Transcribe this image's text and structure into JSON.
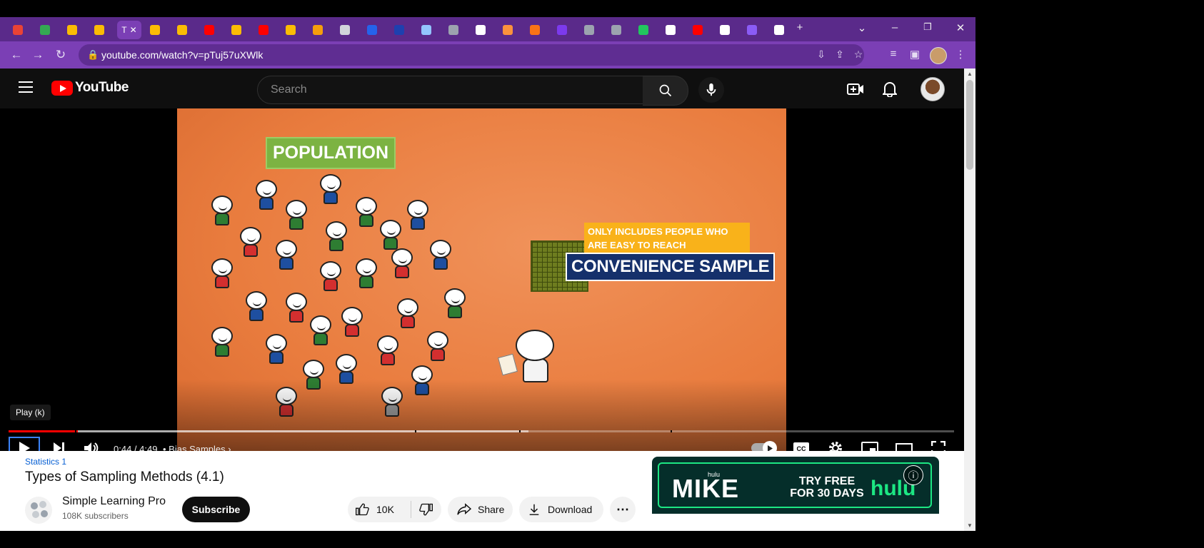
{
  "browser": {
    "url": "youtube.com/watch?v=pTuj57uXWlk",
    "active_tab_letter": "T",
    "tabs": [
      {
        "color": "#ea4335"
      },
      {
        "color": "#34a853"
      },
      {
        "color": "#fbbc04"
      },
      {
        "color": "#fbbc04"
      },
      {
        "color": "active"
      },
      {
        "color": "#fbbc04"
      },
      {
        "color": "#fbbc04"
      },
      {
        "color": "#ff0000"
      },
      {
        "color": "#fbbc04"
      },
      {
        "color": "#ff0000"
      },
      {
        "color": "#fbbc04"
      },
      {
        "color": "#f59e0b"
      },
      {
        "color": "#d1d5db"
      },
      {
        "color": "#2563eb"
      },
      {
        "color": "#1e40af"
      },
      {
        "color": "#93c5fd"
      },
      {
        "color": "#9ca3af"
      },
      {
        "color": "#ffffff"
      },
      {
        "color": "#fb923c"
      },
      {
        "color": "#f97316"
      },
      {
        "color": "#7c3aed"
      },
      {
        "color": "#9ca3af"
      },
      {
        "color": "#9ca3af"
      },
      {
        "color": "#22c55e"
      },
      {
        "color": "#ffffff"
      },
      {
        "color": "#ff0000"
      },
      {
        "color": "#ffffff"
      },
      {
        "color": "#8b5cf6"
      },
      {
        "color": "#ffffff"
      }
    ]
  },
  "youtube": {
    "logo_text": "YouTube",
    "search_placeholder": "Search"
  },
  "video_frame": {
    "population_label": "POPULATION",
    "only_includes_label": "ONLY INCLUDES PEOPLE WHO ARE EASY TO REACH",
    "convenience_label": "CONVENIENCE SAMPLE"
  },
  "player": {
    "tooltip": "Play (k)",
    "time": "0:44 / 4:49",
    "chapter": "Bias Samples",
    "played_fraction": 0.073,
    "chapter_marks": [
      0.07,
      0.43,
      0.54,
      0.7
    ]
  },
  "video": {
    "category": "Statistics 1",
    "title": "Types of Sampling Methods (4.1)",
    "channel": "Simple Learning Pro",
    "subscribers": "108K subscribers",
    "subscribe_label": "Subscribe",
    "likes": "10K",
    "share_label": "Share",
    "download_label": "Download"
  },
  "ad": {
    "brand_small": "hulu",
    "show": "MIKE",
    "cta": "TRY FREE FOR 30 DAYS",
    "brand": "hulu"
  },
  "colors": {
    "tab_strip": "#5a2a8a",
    "toolbar": "#7b3fb5",
    "youtube_red": "#ff0000",
    "progress_red": "#ff0000",
    "hulu_green": "#1ce783"
  }
}
